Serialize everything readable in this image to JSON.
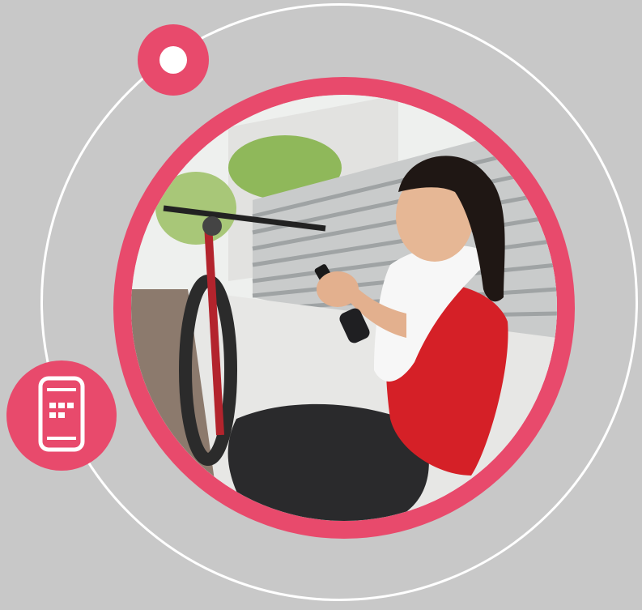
{
  "icons": {
    "dot_badge": "dot-badge-icon",
    "phone_badge": "smartphone-apps-icon"
  },
  "colors": {
    "background": "#c8c8c8",
    "accent": "#e84a6c",
    "ring": "#ffffff"
  }
}
